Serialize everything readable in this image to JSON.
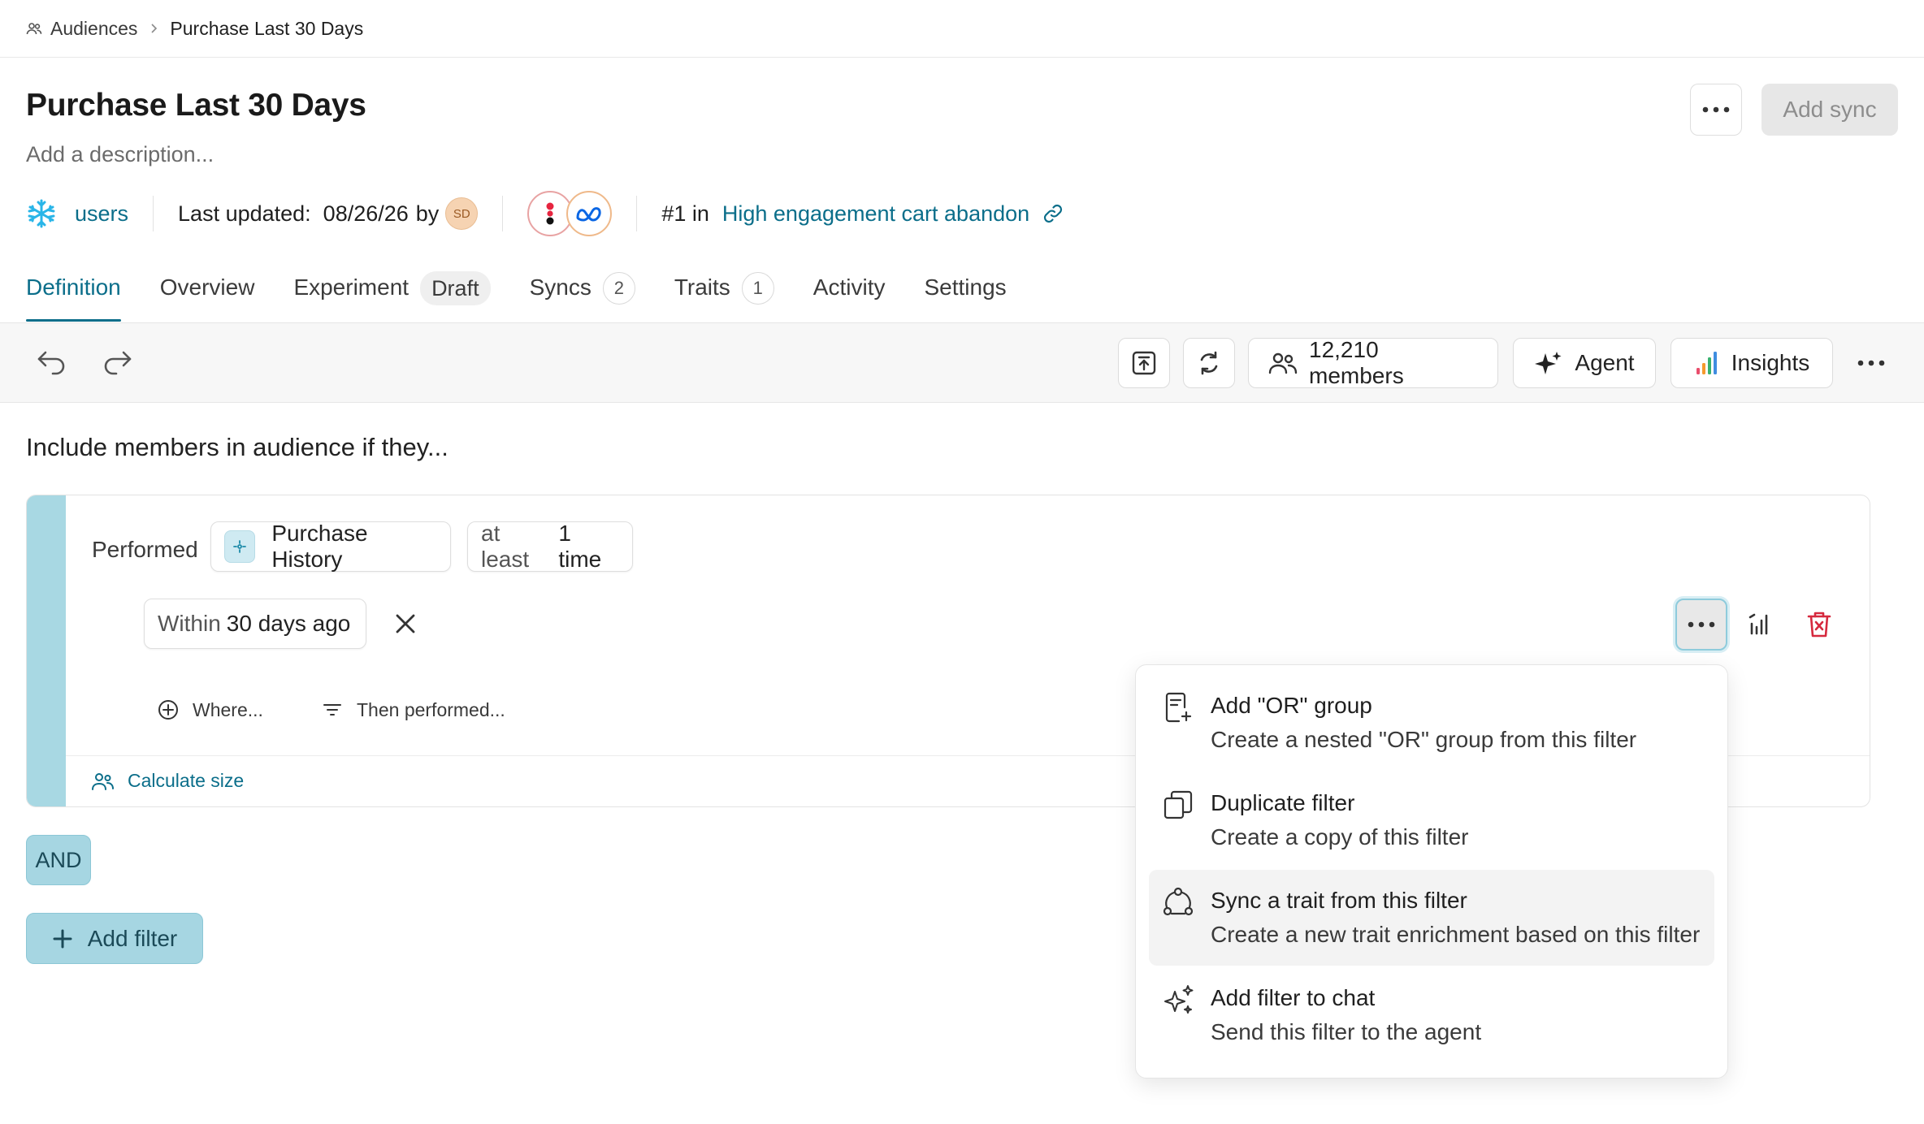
{
  "breadcrumb": {
    "parent": "Audiences",
    "current": "Purchase Last 30 Days"
  },
  "header": {
    "title": "Purchase Last 30 Days",
    "description_placeholder": "Add a description...",
    "add_sync_label": "Add sync"
  },
  "meta": {
    "source_name": "users",
    "last_updated_label": "Last updated:",
    "last_updated_date": "08/26/26",
    "by_label": "by",
    "user_initials": "SD",
    "rank_text": "#1 in",
    "rank_link": "High engagement cart abandon"
  },
  "tabs": [
    {
      "label": "Definition"
    },
    {
      "label": "Overview"
    },
    {
      "label": "Experiment",
      "badge": "Draft"
    },
    {
      "label": "Syncs",
      "count": "2"
    },
    {
      "label": "Traits",
      "count": "1"
    },
    {
      "label": "Activity"
    },
    {
      "label": "Settings"
    }
  ],
  "toolbar": {
    "members_label": "12,210 members",
    "agent_label": "Agent",
    "insights_label": "Insights"
  },
  "filters": {
    "heading": "Include members in audience if they...",
    "performed_label": "Performed",
    "event_name": "Purchase History",
    "frequency_prefix": "at least",
    "frequency_value": "1 time",
    "within_prefix": "Within",
    "within_value": "30 days ago",
    "where_label": "Where...",
    "then_performed_label": "Then performed...",
    "calculate_label": "Calculate size",
    "and_label": "AND",
    "add_filter_label": "Add filter"
  },
  "menu": {
    "items": [
      {
        "title": "Add \"OR\" group",
        "subtitle": "Create a nested \"OR\" group from this filter",
        "icon": "or-group-icon"
      },
      {
        "title": "Duplicate filter",
        "subtitle": "Create a copy of this filter",
        "icon": "duplicate-icon"
      },
      {
        "title": "Sync a trait from this filter",
        "subtitle": "Create a new trait enrichment based on this filter",
        "icon": "sync-trait-icon",
        "hovered": true
      },
      {
        "title": "Add filter to chat",
        "subtitle": "Send this filter to the agent",
        "icon": "sparkle-icon"
      }
    ]
  },
  "colors": {
    "accent": "#0b6e8a",
    "stripe": "#a8d8e3",
    "danger": "#d6293e"
  }
}
